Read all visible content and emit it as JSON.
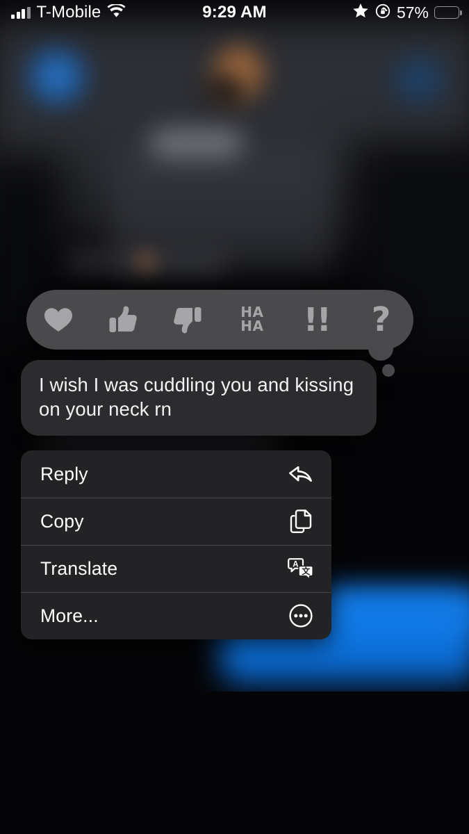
{
  "status_bar": {
    "carrier": "T-Mobile",
    "signal_icon": "cellular-bars-icon",
    "wifi_icon": "wifi-icon",
    "time": "9:29 AM",
    "star_icon": "star-icon",
    "rotation_lock_icon": "rotation-lock-icon",
    "battery_percent": "57%",
    "battery_icon": "battery-icon",
    "battery_fill_color": "#fcd11a"
  },
  "tapback_bar": {
    "reactions": [
      {
        "name": "heart-reaction",
        "glyph": "heart"
      },
      {
        "name": "thumbs-up-reaction",
        "glyph": "thumbsup"
      },
      {
        "name": "thumbs-down-reaction",
        "glyph": "thumbsdown"
      },
      {
        "name": "haha-reaction",
        "line1": "HA",
        "line2": "HA"
      },
      {
        "name": "exclamation-reaction",
        "glyph": "!!"
      },
      {
        "name": "question-reaction",
        "glyph": "?"
      }
    ],
    "background_color": "#4a4a4c",
    "icon_color": "#a5a5a7"
  },
  "message": {
    "text": "I wish I was cuddling you and kissing on your neck rn",
    "bubble_color": "#2c2c2e",
    "text_color": "#f2f2f4",
    "side": "received"
  },
  "context_menu": {
    "items": [
      {
        "label": "Reply",
        "icon": "reply-arrow-icon"
      },
      {
        "label": "Copy",
        "icon": "copy-documents-icon"
      },
      {
        "label": "Translate",
        "icon": "translate-bubbles-icon"
      },
      {
        "label": "More...",
        "icon": "ellipsis-circle-icon"
      }
    ],
    "background_color": "#232326",
    "separator_color": "#49494c"
  },
  "background": {
    "description_blurred": true,
    "sent_bubble_color": "#0d73e0",
    "header_color": "#2e3036",
    "page_color": "#050507"
  }
}
